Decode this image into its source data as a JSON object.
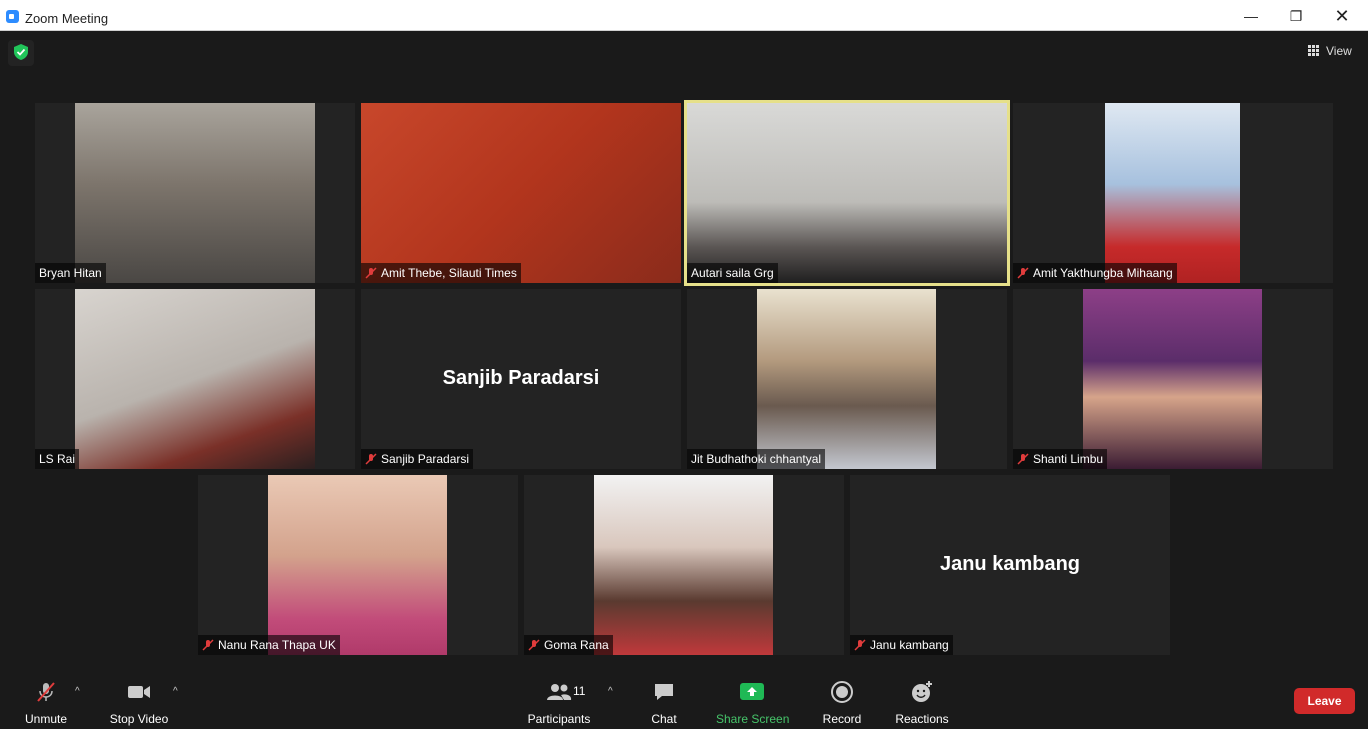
{
  "window": {
    "title": "Zoom Meeting",
    "minimize": "—",
    "maximize": "❐",
    "close": "✕"
  },
  "header": {
    "view_label": "View"
  },
  "participants": [
    {
      "name": "Bryan Hitan",
      "muted": false,
      "video": true,
      "active": false
    },
    {
      "name": "Amit Thebe, Silauti Times",
      "muted": true,
      "video": true,
      "active": false
    },
    {
      "name": "Autari saila Grg",
      "muted": false,
      "video": true,
      "active": true
    },
    {
      "name": "Amit Yakthungba Mihaang",
      "muted": true,
      "video": true,
      "active": false
    },
    {
      "name": "LS Rai",
      "muted": false,
      "video": true,
      "active": false
    },
    {
      "name": "Sanjib Paradarsi",
      "muted": true,
      "video": false,
      "active": false
    },
    {
      "name": "Jit Budhathoki chhantyal",
      "muted": false,
      "video": true,
      "active": false
    },
    {
      "name": "Shanti Limbu",
      "muted": true,
      "video": true,
      "active": false
    },
    {
      "name": "Nanu Rana Thapa UK",
      "muted": true,
      "video": true,
      "active": false
    },
    {
      "name": "Goma Rana",
      "muted": true,
      "video": true,
      "active": false
    },
    {
      "name": "Janu kambang",
      "muted": true,
      "video": false,
      "active": false
    }
  ],
  "toolbar": {
    "unmute": "Unmute",
    "stop_video": "Stop Video",
    "participants": "Participants",
    "participant_count": "11",
    "chat": "Chat",
    "share_screen": "Share Screen",
    "record": "Record",
    "reactions": "Reactions",
    "leave": "Leave"
  },
  "colors": {
    "active_border": "#e6e08a",
    "share_green": "#46c46a",
    "leave_red": "#d12a2a",
    "mute_red": "#e03c3c"
  }
}
